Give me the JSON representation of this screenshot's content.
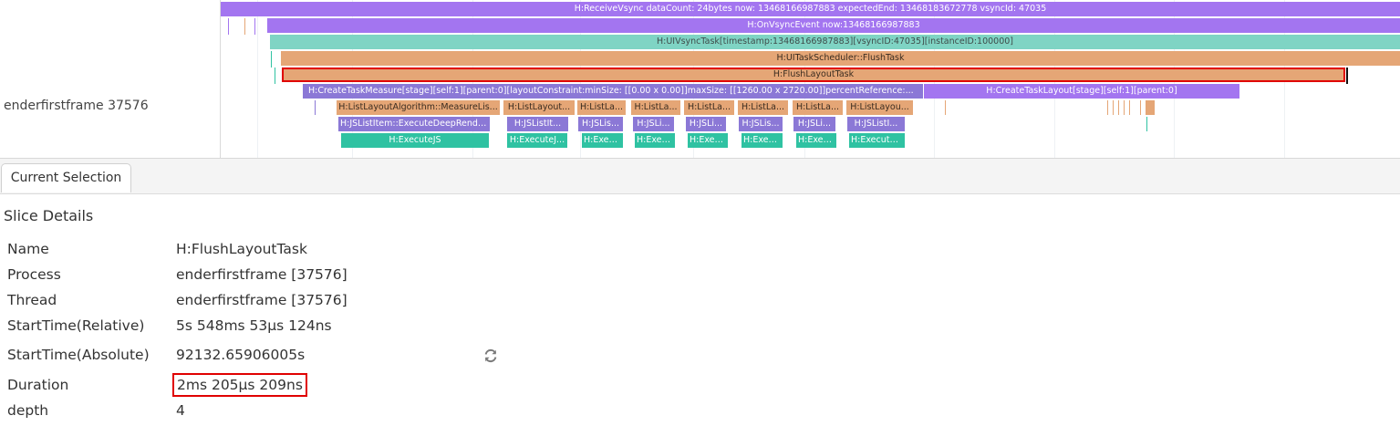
{
  "trace": {
    "lane_label": "enderfirstframe 37576",
    "slices": [
      {
        "label": "H:ReceiveVsync dataCount: 24bytes now: 13468166987883 expectedEnd: 13468183672778 vsyncId: 47035"
      },
      {
        "label": "H:OnVsyncEvent now:13468166987883"
      },
      {
        "label": "H:UIVsyncTask[timestamp:13468166987883][vsyncID:47035][instanceID:100000]"
      },
      {
        "label": "H:UITaskScheduler::FlushTask"
      },
      {
        "label": "H:FlushLayoutTask"
      },
      {
        "label": "H:CreateTaskMeasure[stage][self:1][parent:0][layoutConstraint:minSize: [[0.00 x 0.00]]maxSize: [[1260.00 x 2720.00]]percentReference:..."
      },
      {
        "label": "H:CreateTaskLayout[stage][self:1][parent:0]"
      },
      {
        "label": "H:ListLayoutAlgorithm::MeasureLis..."
      },
      {
        "label": "H:ListLayout..."
      },
      {
        "label": "H:ListLa..."
      },
      {
        "label": "H:ListLa..."
      },
      {
        "label": "H:ListLa..."
      },
      {
        "label": "H:ListLa..."
      },
      {
        "label": "H:ListLa..."
      },
      {
        "label": "H:ListLayou..."
      },
      {
        "label": "H:JSListItem::ExecuteDeepRende..."
      },
      {
        "label": "H:JSListIt..."
      },
      {
        "label": "H:JSLis..."
      },
      {
        "label": "H:JSLi..."
      },
      {
        "label": "H:JSLi..."
      },
      {
        "label": "H:JSLis..."
      },
      {
        "label": "H:JSLi..."
      },
      {
        "label": "H:JSListI..."
      },
      {
        "label": "H:ExecuteJS"
      },
      {
        "label": "H:ExecuteJ..."
      },
      {
        "label": "H:Exec..."
      },
      {
        "label": "H:Exec..."
      },
      {
        "label": "H:Exec..."
      },
      {
        "label": "H:Exec..."
      },
      {
        "label": "H:Exec..."
      },
      {
        "label": "H:Execute..."
      }
    ]
  },
  "tabs": {
    "current_selection": "Current Selection"
  },
  "details": {
    "title": "Slice Details",
    "rows": [
      {
        "key": "Name",
        "value": "H:FlushLayoutTask"
      },
      {
        "key": "Process",
        "value": "enderfirstframe [37576]"
      },
      {
        "key": "Thread",
        "value": "enderfirstframe [37576]"
      },
      {
        "key": "StartTime(Relative)",
        "value": "5s 548ms 53μs 124ns"
      },
      {
        "key": "StartTime(Absolute)",
        "value": "92132.65906005s"
      },
      {
        "key": "Duration",
        "value": "2ms 205μs 209ns"
      },
      {
        "key": "depth",
        "value": "4"
      }
    ]
  },
  "icons": {
    "refresh": "refresh-icon"
  },
  "colors": {
    "selection_highlight": "#e00000",
    "slice_purple": "#a375f0",
    "slice_teal": "#7fd4c4",
    "slice_orange": "#e5a676",
    "slice_violet": "#8b78d6",
    "slice_green": "#2fc2a2"
  }
}
